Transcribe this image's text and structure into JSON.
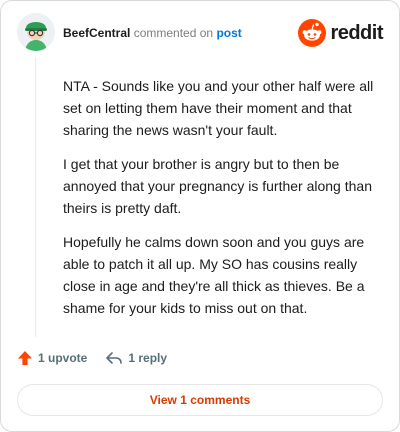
{
  "header": {
    "username": "BeefCentral",
    "action_text": "commented on",
    "post_link": "post",
    "brand": "reddit"
  },
  "comment": {
    "paragraphs": [
      "NTA - Sounds like you and your other half were all set on letting them have their moment and that sharing the news wasn't your fault.",
      "I get that your brother is angry but to then be annoyed that your pregnancy is further along than theirs is pretty daft.",
      "Hopefully he calms down soon and you guys are able to patch it all up. My SO has cousins really close in age and they're all thick as thieves. Be a shame for your kids to miss out on that."
    ]
  },
  "actions": {
    "upvotes": "1 upvote",
    "replies": "1 reply"
  },
  "footer": {
    "view_button": "View 1 comments"
  },
  "colors": {
    "brand_orange": "#ff4500",
    "upvote_orange": "#ff4500",
    "link_blue": "#0079d3",
    "view_text": "#d93a00"
  }
}
